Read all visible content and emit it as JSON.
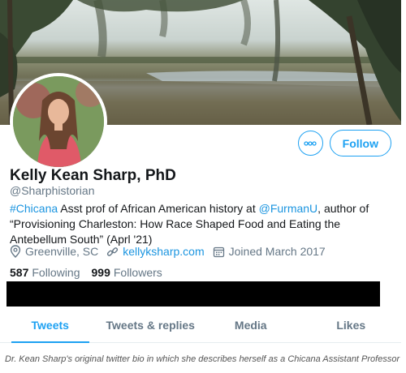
{
  "profile": {
    "name": "Kelly Kean Sharp, PhD",
    "handle": "@Sharphistorian",
    "bio": {
      "hashtag": "#Chicana",
      "text1": " Asst prof of African American history at ",
      "mention": "@FurmanU",
      "text2": ", author of “Provisioning Charleston: How Race Shaped Food and Eating the Antebellum South” (Aprl '21)"
    },
    "location": "Greenville, SC",
    "website": "kellyksharp.com",
    "joined": "Joined March 2017",
    "following_count": "587",
    "following_label": "Following",
    "followers_count": "999",
    "followers_label": "Followers"
  },
  "actions": {
    "more_icon": "more-dots-icon",
    "follow_label": "Follow"
  },
  "tabs": [
    {
      "label": "Tweets",
      "active": true
    },
    {
      "label": "Tweets & replies",
      "active": false
    },
    {
      "label": "Media",
      "active": false
    },
    {
      "label": "Likes",
      "active": false
    }
  ],
  "caption": "Dr. Kean Sharp's original twitter bio in which she describes herself as a Chicana Assistant Professor",
  "colors": {
    "accent": "#1da1f2",
    "muted": "#657786",
    "text": "#14171a"
  }
}
